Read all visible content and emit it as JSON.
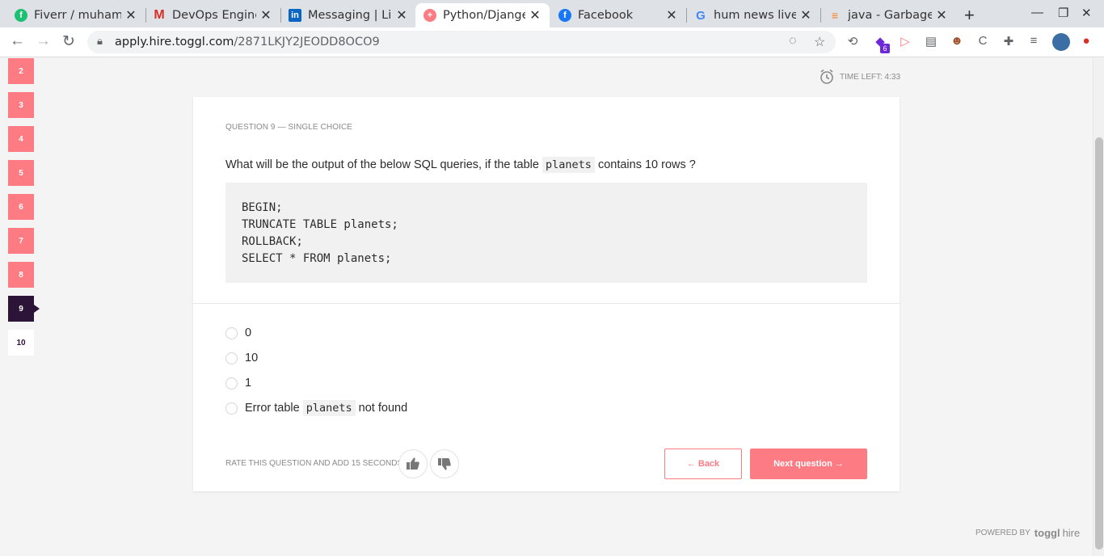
{
  "browser": {
    "tabs": [
      {
        "title": "Fiverr / muham",
        "icon": "fiverr-icon",
        "color": "#1dbf73"
      },
      {
        "title": "DevOps Engine",
        "icon": "gmail-icon",
        "color": "#d93025"
      },
      {
        "title": "Messaging | Lin",
        "icon": "linkedin-icon",
        "color": "#0a66c2"
      },
      {
        "title": "Python/Djange",
        "icon": "toggl-icon",
        "color": "#fd7c84",
        "active": true
      },
      {
        "title": "Facebook",
        "icon": "facebook-icon",
        "color": "#1877f2"
      },
      {
        "title": "hum news live",
        "icon": "google-icon",
        "color": "#4285f4"
      },
      {
        "title": "java - Garbage",
        "icon": "stackoverflow-icon",
        "color": "#f48024"
      }
    ],
    "url_host": "apply.hire.toggl.com",
    "url_path": "/2871LKJY2JEODD8OCO9",
    "extension_badge": "6"
  },
  "quiz": {
    "nav_items": [
      "2",
      "3",
      "4",
      "5",
      "6",
      "7",
      "8",
      "9",
      "10"
    ],
    "current": "9",
    "timer_label": "TIME LEFT: 4:33",
    "question_label": "QUESTION 9 — SINGLE CHOICE",
    "question_text_before": "What will be the output of the below SQL queries, if the table",
    "question_code": "planets",
    "question_text_after": "contains 10 rows ?",
    "code_lines": [
      "BEGIN;",
      "TRUNCATE TABLE planets;",
      "ROLLBACK;",
      "SELECT * FROM planets;"
    ],
    "options": [
      {
        "before": "0"
      },
      {
        "before": "10"
      },
      {
        "before": "1"
      },
      {
        "before": "Error table",
        "code": "planets",
        "after": "not found"
      }
    ],
    "rate_label": "RATE THIS QUESTION AND ADD 15 SECONDS:",
    "back_label": "← Back",
    "next_label": "Next question →",
    "powered_label": "POWERED BY",
    "powered_brand": "toggl",
    "powered_brand_suffix": "hire"
  },
  "colors": {
    "accent": "#fd7c84",
    "current": "#2c1338"
  }
}
